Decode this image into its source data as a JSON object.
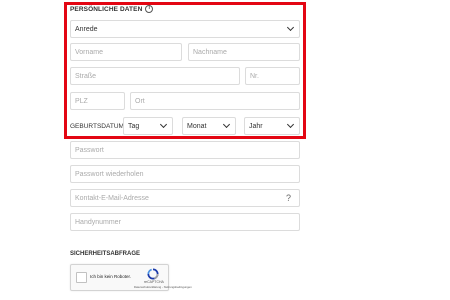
{
  "section": {
    "title": "PERSÖNLICHE DATEN",
    "info_icon": "i"
  },
  "fields": {
    "salutation": "Anrede",
    "firstname": "Vorname",
    "lastname": "Nachname",
    "street": "Straße",
    "number": "Nr.",
    "zip": "PLZ",
    "city": "Ort",
    "birthdate_label": "GEBURTSDATUM",
    "day": "Tag",
    "month": "Monat",
    "year": "Jahr",
    "password": "Passwort",
    "password_repeat": "Passwort wiederholen",
    "email": "Kontakt-E-Mail-Adresse",
    "email_help": "?",
    "mobile": "Handynummer"
  },
  "captcha": {
    "title": "SICHERHEITSABFRAGE",
    "label": "Ich bin kein Roboter.",
    "brand": "reCAPTCHA",
    "links": "Datenschutzerklärung - Nutzungsbedingungen"
  },
  "colors": {
    "highlight": "#e30613",
    "border": "#dcdcdc",
    "placeholder": "#aaaaaa"
  }
}
